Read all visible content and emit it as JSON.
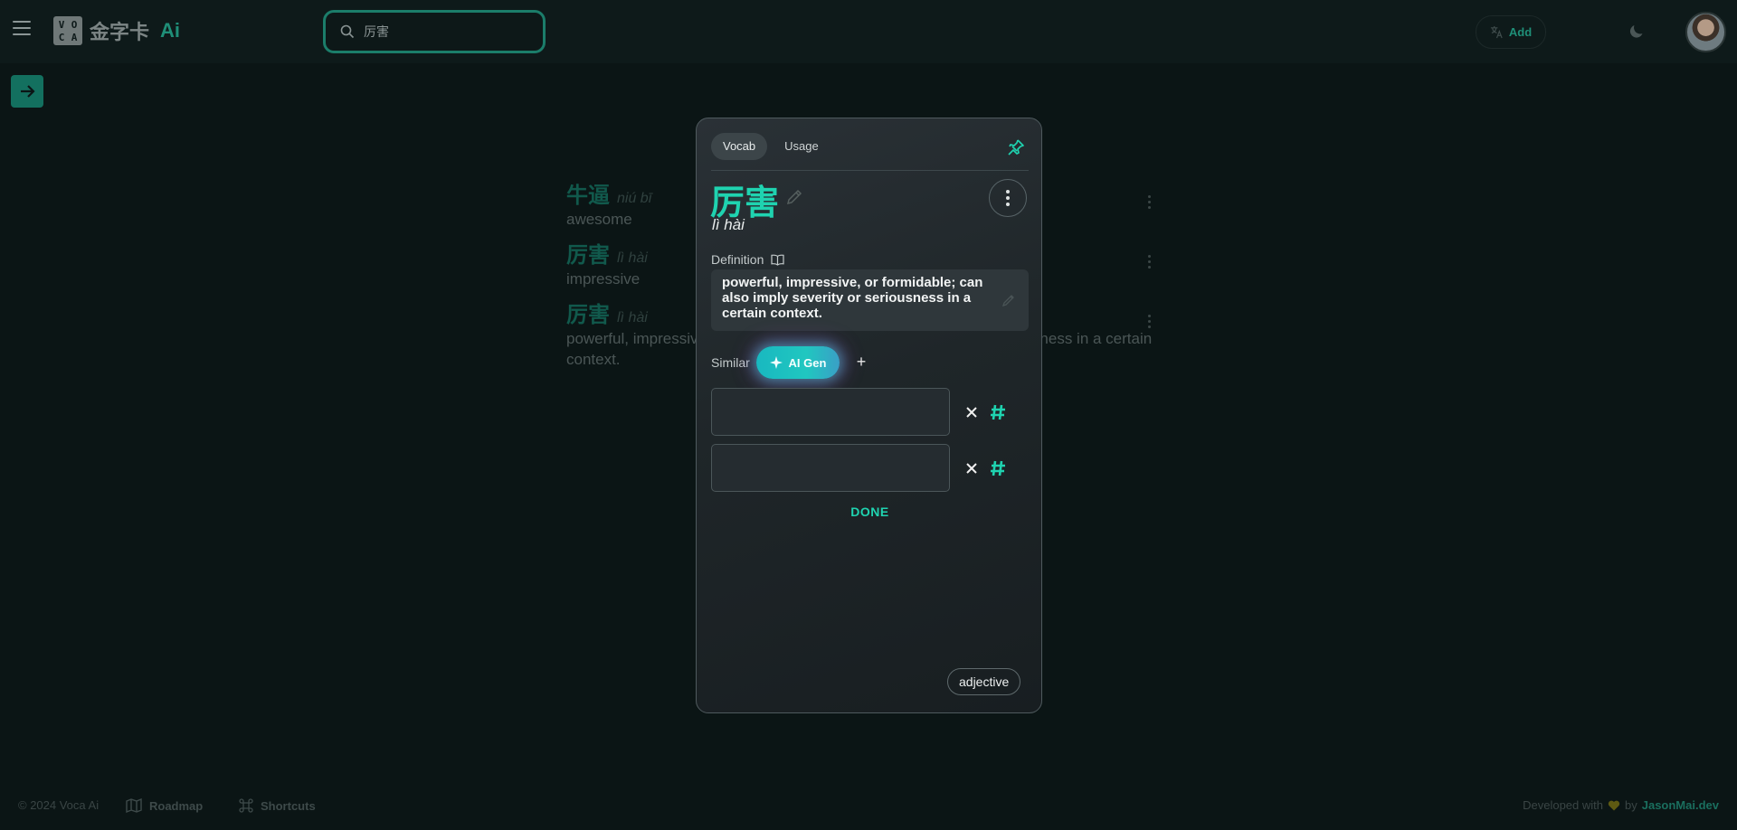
{
  "app": {
    "logo_letters": [
      "V",
      "O",
      "C",
      "A"
    ],
    "logo_text": "金字卡",
    "logo_ai": "Ai",
    "accent_color": "#1fd3b0"
  },
  "search": {
    "value": "厉害"
  },
  "header": {
    "add_label": "Add"
  },
  "background_list": [
    {
      "word": "牛逼",
      "pinyin": "niú bī",
      "definition": "awesome"
    },
    {
      "word": "厉害",
      "pinyin": "lì hài",
      "definition": "impressive"
    },
    {
      "word": "厉害",
      "pinyin": "lì hài",
      "definition": "powerful, impressive, or formidable; can also imply severity or seriousness in a certain context."
    }
  ],
  "modal": {
    "tabs": [
      "Vocab",
      "Usage"
    ],
    "active_tab": "Vocab",
    "word": "厉害",
    "pinyin": "lì hài",
    "definition_label": "Definition",
    "definition": "powerful, impressive, or formidable; can also imply severity or seriousness in a certain context.",
    "similar_label": "Similar",
    "ai_gen_label": "AI Gen",
    "similar_inputs": [
      "",
      ""
    ],
    "done_label": "DONE",
    "part_of_speech": "adjective"
  },
  "footer": {
    "copyright": "© 2024 Voca Ai",
    "roadmap_label": "Roadmap",
    "shortcuts_label": "Shortcuts",
    "developed_with": "Developed with",
    "by": "by",
    "author": "JasonMai.dev"
  }
}
